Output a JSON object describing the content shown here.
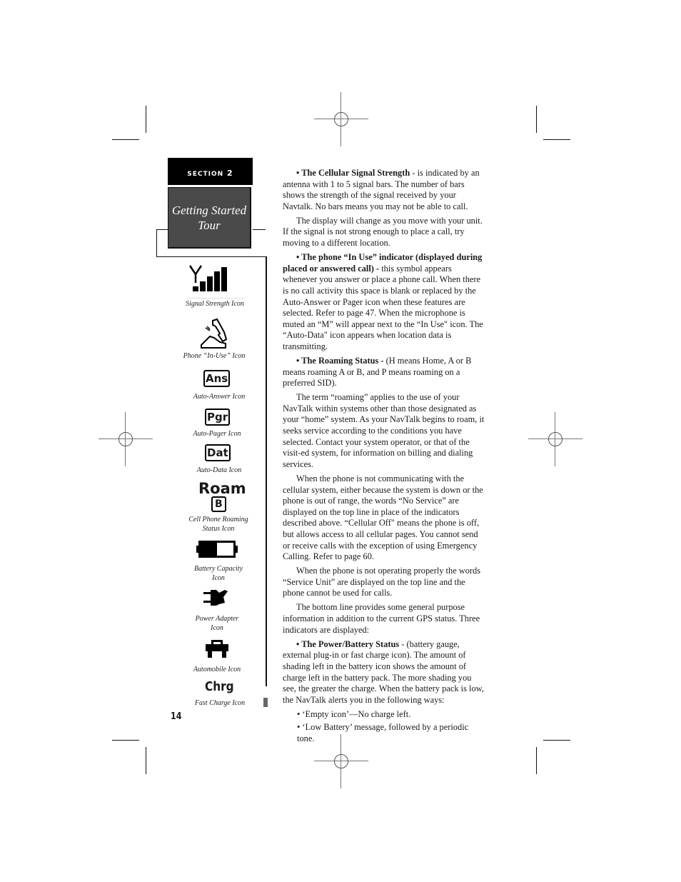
{
  "section": {
    "label_prefix": "Section",
    "label_number": "2",
    "title_line1": "Getting Started",
    "title_line2": "Tour"
  },
  "icons": [
    {
      "name": "signal-strength-icon",
      "caption": "Signal Strength Icon"
    },
    {
      "name": "phone-in-use-icon",
      "caption": "Phone  “In-Use” Icon"
    },
    {
      "name": "auto-answer-icon",
      "glyph": "Ans",
      "caption": "Auto-Answer Icon"
    },
    {
      "name": "auto-pager-icon",
      "glyph": "Pgr",
      "caption": "Auto-Pager Icon"
    },
    {
      "name": "auto-data-icon",
      "glyph": "Dat",
      "caption": "Auto-Data Icon"
    },
    {
      "name": "roaming-status-icon",
      "glyph": "Roam",
      "glyph2": "B",
      "caption_line1": "Cell Phone Roaming",
      "caption_line2": "Status Icon"
    },
    {
      "name": "battery-capacity-icon",
      "caption_line1": "Battery Capacity",
      "caption_line2": "Icon",
      "charge_fraction": 0.5
    },
    {
      "name": "power-adapter-icon",
      "caption_line1": "Power Adapter",
      "caption_line2": "Icon"
    },
    {
      "name": "automobile-icon",
      "caption": "Automobile Icon"
    },
    {
      "name": "fast-charge-icon",
      "glyph": "Chrg",
      "caption": "Fast Charge Icon"
    }
  ],
  "body": {
    "p1_bold": "• The Cellular Signal Strength",
    "p1_text": " - is indicated by an antenna with 1 to 5 signal bars. The number of bars shows the strength of the signal received by your Navtalk. No bars means you may not be able to call.",
    "p2": "The display will change as you move with your unit. If the signal is not strong enough to place a call, try moving to a different location.",
    "p3_bold": "• The phone “In Use” indicator (displayed during placed or answered call) -",
    "p3_text": " this symbol appears whenever you answer or place a phone call. When there is no call activity this space is blank or replaced by the Auto-Answer or Pager icon when these features are selected. Refer to page 47. When the microphone is muted an “M” will appear next to the “In Use\" icon. The “Auto-Data\" icon appears when location data is transmitting.",
    "p4_bold": "• The Roaming Status -",
    "p4_text": " (H means Home, A or B means roaming A or B, and P means roaming on a preferred SID).",
    "p5": "The term “roaming” applies to the use of your NavTalk within systems other than those designated as your “home” system. As your NavTalk begins to roam, it seeks service according to the conditions you have selected. Contact your system operator, or that of the visit-ed system, for information on billing and dialing services.",
    "p6": "When the phone is not communicating with the cellular system, either because the system is down or the phone is out of range, the words “No Service” are displayed on the top line in place of the indicators described above. “Cellular Off\" means the phone is off, but allows access to all cellular pages. You cannot send or receive calls with the exception of using Emergency Calling. Refer to page 60.",
    "p7": "When the phone is not operating properly the words “Service Unit” are displayed on the top line and the phone cannot be used for calls.",
    "p8": "The bottom line provides some general purpose information in addition to the current GPS status. Three indicators are displayed:",
    "p9_bold": "• The Power/Battery Status",
    "p9_text": " - (battery gauge, external plug-in or fast charge icon). The amount of shading left in the battery icon shows the amount of charge left in the battery pack. The more shading you see, the greater the charge. When the battery pack is low, the NavTalk alerts you in the following ways:",
    "bullets": [
      "• ‘Empty icon’—No charge left.",
      "• ‘Low Battery’ message, followed by a periodic tone."
    ]
  },
  "page_number": "14"
}
